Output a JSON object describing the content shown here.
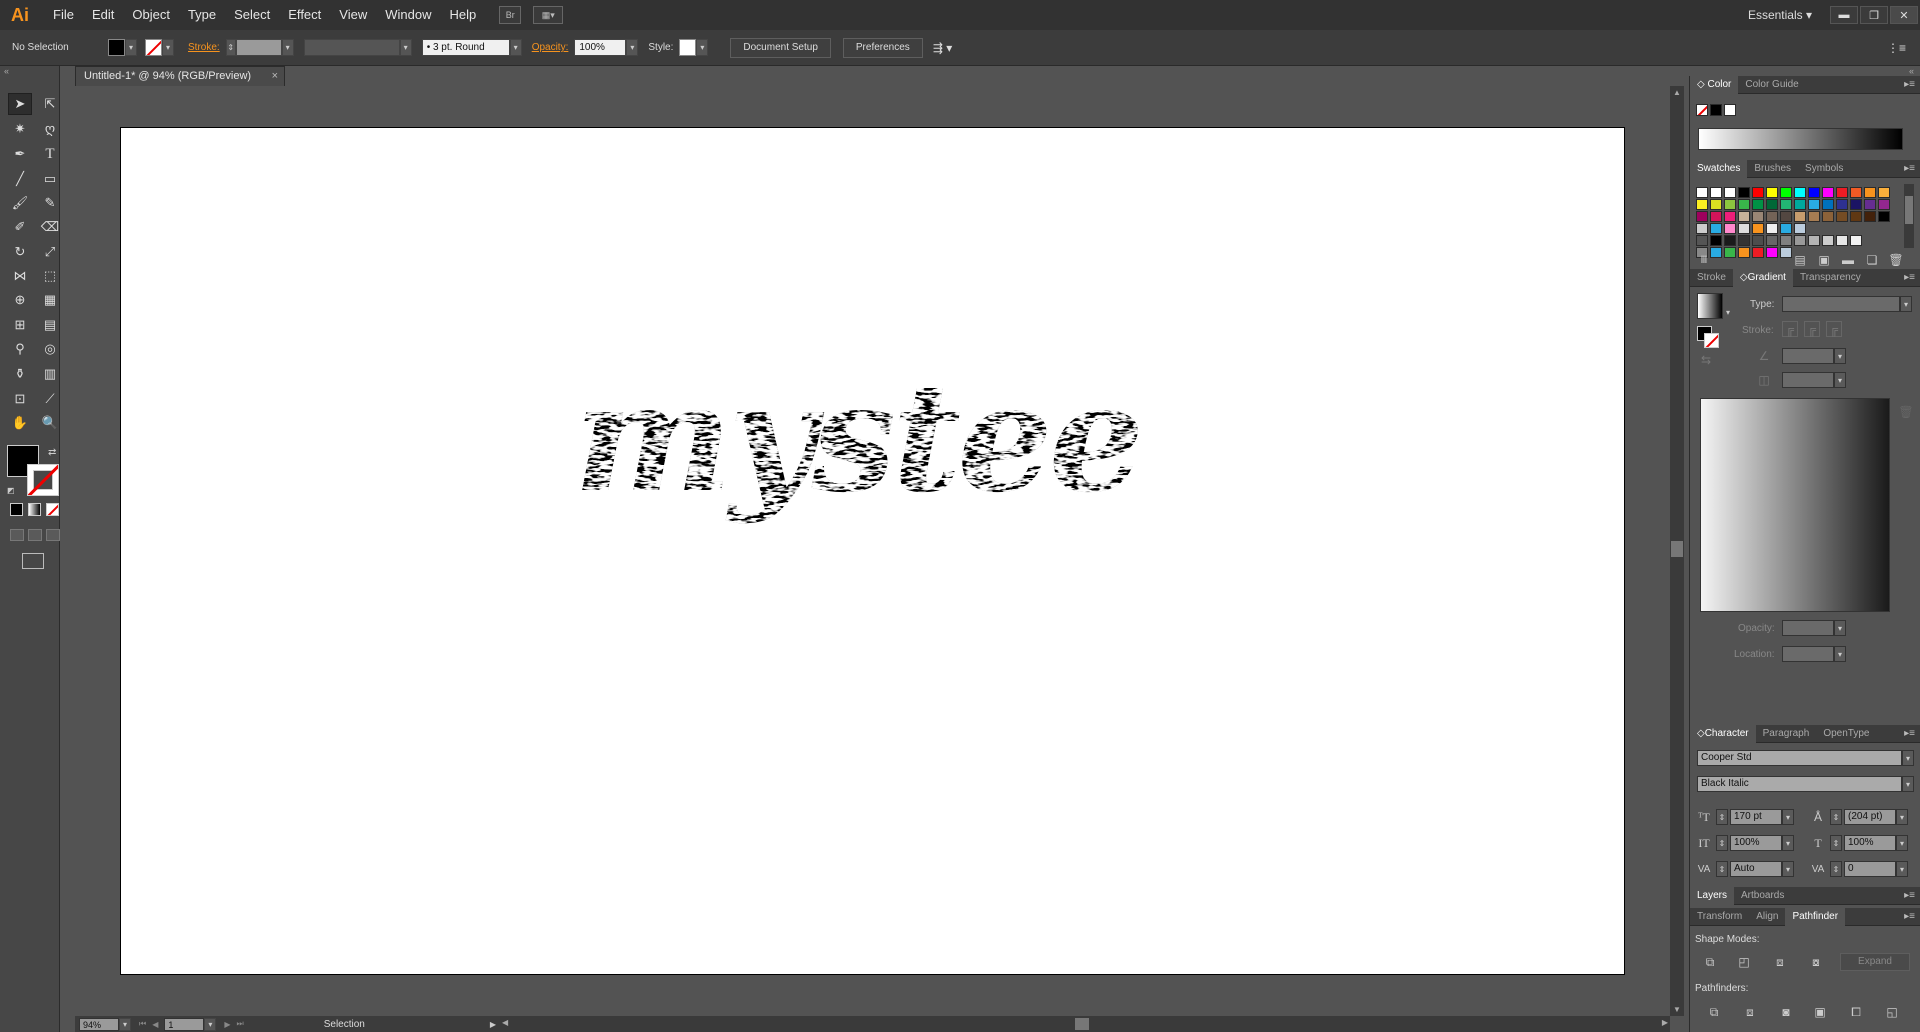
{
  "app": {
    "logo": "Ai"
  },
  "menu": [
    "File",
    "Edit",
    "Object",
    "Type",
    "Select",
    "Effect",
    "View",
    "Window",
    "Help"
  ],
  "menubar_buttons": {
    "bridge": "Br",
    "arrange": "▦▾"
  },
  "workspace": {
    "label": "Essentials"
  },
  "window_controls": {
    "minimize": "▬",
    "restore": "❐",
    "close": "✕"
  },
  "controlbar": {
    "selection": "No Selection",
    "stroke_label": "Stroke:",
    "brush": "3 pt. Round",
    "opacity_label": "Opacity:",
    "opacity_value": "100%",
    "style_label": "Style:",
    "document_setup": "Document Setup",
    "preferences": "Preferences"
  },
  "document": {
    "tab_title": "Untitled-1* @ 94% (RGB/Preview)",
    "artwork_text": "mystee"
  },
  "status": {
    "zoom": "94%",
    "artboard": "1",
    "tool": "Selection"
  },
  "colors": {
    "accent": "#f7931e",
    "chrome_dark": "#323232",
    "panel": "#535353"
  },
  "panels": {
    "color_tabs": [
      "Color",
      "Color Guide"
    ],
    "swatches_tabs": [
      "Swatches",
      "Brushes",
      "Symbols"
    ],
    "gradient_tabs": [
      "Stroke",
      "Gradient",
      "Transparency"
    ],
    "gradient": {
      "type_label": "Type:",
      "stroke_label": "Stroke:",
      "opacity_label": "Opacity:",
      "location_label": "Location:"
    },
    "character_tabs": [
      "Character",
      "Paragraph",
      "OpenType"
    ],
    "character": {
      "font_family": "Cooper Std",
      "font_style": "Black Italic",
      "font_size": "170 pt",
      "leading": "(204 pt)",
      "vertical_scale": "100%",
      "horizontal_scale": "100%",
      "kerning": "Auto",
      "tracking": "0"
    },
    "layers_tabs": [
      "Layers",
      "Artboards"
    ],
    "pathfinder_tabs": [
      "Transform",
      "Align",
      "Pathfinder"
    ],
    "pathfinder": {
      "shape_modes_label": "Shape Modes:",
      "pathfinders_label": "Pathfinders:",
      "expand": "Expand"
    }
  }
}
